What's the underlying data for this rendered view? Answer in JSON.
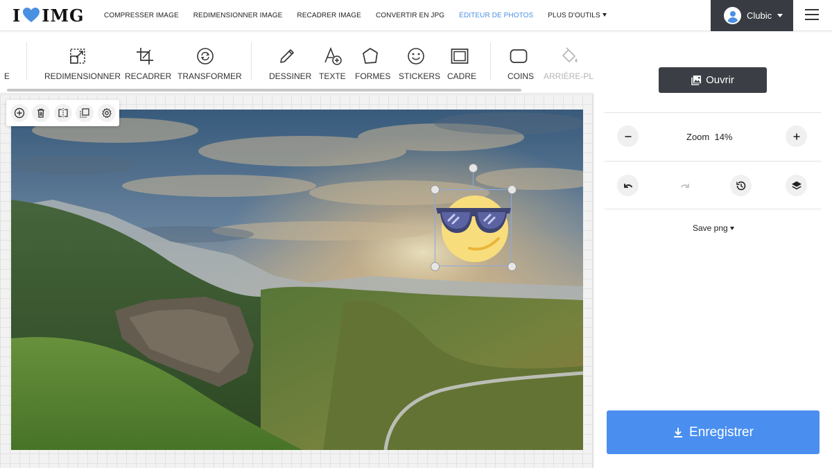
{
  "brand": {
    "logo_left": "I",
    "logo_right": "IMG",
    "accent": "#4a90e2"
  },
  "nav": {
    "links": [
      {
        "label": "COMPRESSER IMAGE",
        "active": false
      },
      {
        "label": "REDIMENSIONNER IMAGE",
        "active": false
      },
      {
        "label": "RECADRER IMAGE",
        "active": false
      },
      {
        "label": "CONVERTIR EN JPG",
        "active": false
      },
      {
        "label": "ÉDITEUR DE PHOTOS",
        "active": true
      },
      {
        "label": "PLUS D'OUTILS",
        "active": false,
        "dropdown": true
      }
    ],
    "user": {
      "name": "Clubic"
    },
    "menu_icon": "hamburger-icon"
  },
  "toolbar": {
    "partial_left": "E",
    "tools": [
      {
        "label": "REDIMENSIONNER",
        "icon": "resize-icon"
      },
      {
        "label": "RECADRER",
        "icon": "crop-icon"
      },
      {
        "label": "TRANSFORMER",
        "icon": "transform-icon"
      },
      {
        "label": "DESSINER",
        "icon": "pencil-icon"
      },
      {
        "label": "TEXTE",
        "icon": "text-add-icon"
      },
      {
        "label": "FORMES",
        "icon": "shapes-icon"
      },
      {
        "label": "STICKERS",
        "icon": "smiley-icon"
      },
      {
        "label": "CADRE",
        "icon": "frame-icon"
      },
      {
        "label": "COINS",
        "icon": "rounded-corners-icon"
      },
      {
        "label": "ARRIÈRE-PL",
        "icon": "paint-bucket-icon",
        "disabled": true
      }
    ]
  },
  "object_tools": [
    "add-icon",
    "trash-icon",
    "flip-icon",
    "duplicate-icon",
    "settings-icon"
  ],
  "panel": {
    "open_label": "Ouvrir",
    "zoom_label": "Zoom",
    "zoom_value": "14%",
    "save_format": "Save png",
    "save_label": "Enregistrer",
    "save_color": "#4a8ff0"
  }
}
